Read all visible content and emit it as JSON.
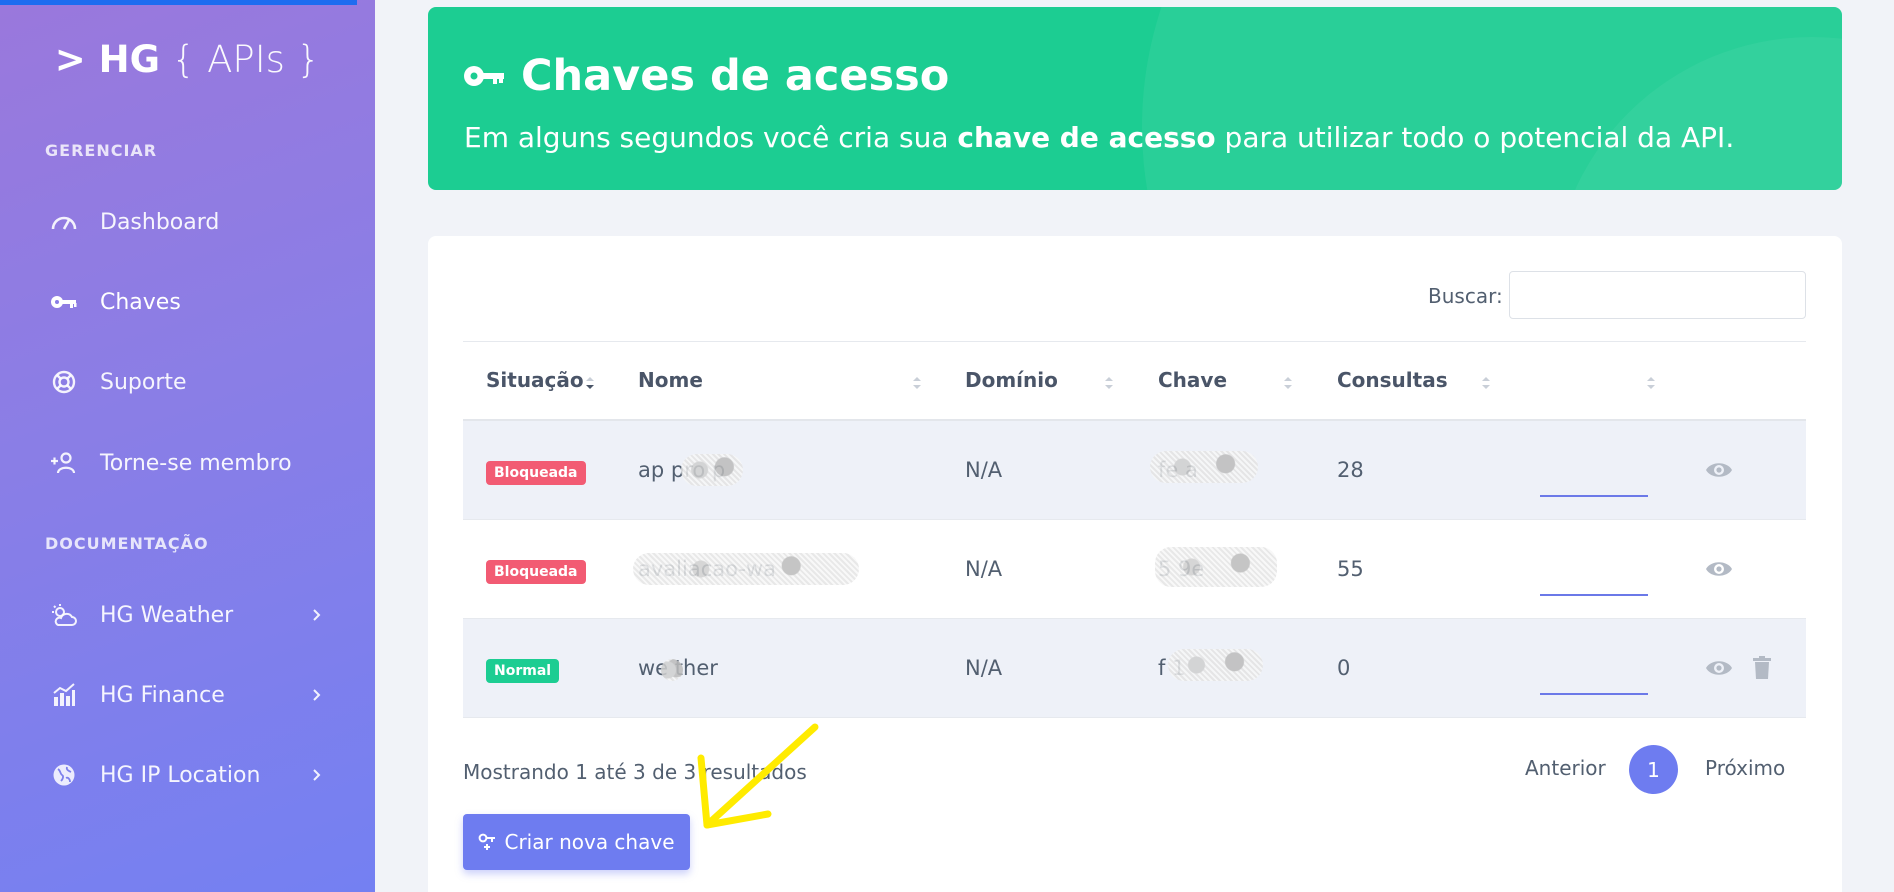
{
  "sidebar": {
    "logo": {
      "prefix": "> HG",
      "braces": "{ APIs }"
    },
    "sections": {
      "manage": "GERENCIAR",
      "docs": "DOCUMENTAÇÃO"
    },
    "items": [
      {
        "label": "Dashboard",
        "icon": "gauge-icon"
      },
      {
        "label": "Chaves",
        "icon": "key-icon",
        "active": true
      },
      {
        "label": "Suporte",
        "icon": "lifebuoy-icon"
      },
      {
        "label": "Torne-se membro",
        "icon": "user-plus-icon"
      },
      {
        "label": "HG Weather",
        "icon": "weather-icon"
      },
      {
        "label": "HG Finance",
        "icon": "chart-icon"
      },
      {
        "label": "HG IP Location",
        "icon": "globe-icon"
      }
    ]
  },
  "banner": {
    "title": "Chaves de acesso",
    "subtitle_before": "Em alguns segundos você cria sua ",
    "subtitle_bold": "chave de acesso",
    "subtitle_after": " para utilizar todo o potencial da API."
  },
  "table": {
    "search_label": "Buscar:",
    "search_value": "",
    "headers": [
      "Situação",
      "Nome",
      "Domínio",
      "Chave",
      "Consultas"
    ],
    "rows": [
      {
        "status": "Bloqueada",
        "name": "ap  pro  p",
        "domain": "N/A",
        "key": "  fe  a  ",
        "queries": "28"
      },
      {
        "status": "Bloqueada",
        "name": "avaliacao-wa",
        "domain": "N/A",
        "key": "  5  9e  ",
        "queries": "55"
      },
      {
        "status": "Normal",
        "name": "we  ther",
        "domain": "N/A",
        "key": "f    1    ",
        "queries": "0"
      }
    ],
    "info": "Mostrando 1 até 3 de 3 resultados",
    "pagination": {
      "prev": "Anterior",
      "page": "1",
      "next": "Próximo"
    }
  },
  "actions": {
    "create_key": "Criar nova chave"
  },
  "colors": {
    "accent": "#6e7cf0",
    "success": "#1ccd92",
    "danger": "#f25b73",
    "annotation": "#ffeb00"
  }
}
